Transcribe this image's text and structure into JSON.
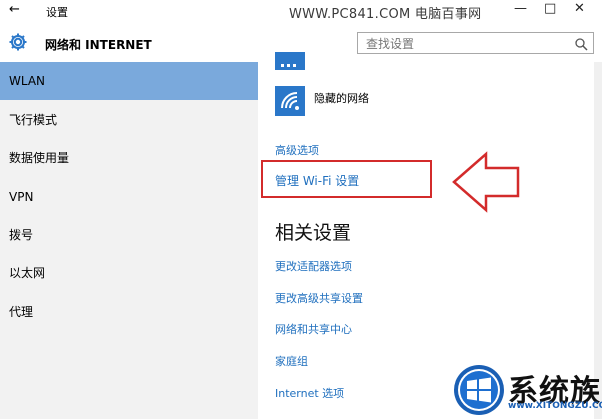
{
  "titlebar": {
    "back_glyph": "←",
    "title": "设置",
    "watermark": "WWW.PC841.COM 电脑百事网",
    "minimize": "—",
    "maximize": "□",
    "close": "✕"
  },
  "header": {
    "title": "网络和 INTERNET",
    "search_placeholder": "查找设置"
  },
  "sidebar": {
    "items": [
      {
        "label": "WLAN"
      },
      {
        "label": "飞行模式"
      },
      {
        "label": "数据使用量"
      },
      {
        "label": "VPN"
      },
      {
        "label": "拨号"
      },
      {
        "label": "以太网"
      },
      {
        "label": "代理"
      }
    ]
  },
  "main": {
    "hidden_network_label": "隐藏的网络",
    "advanced_options": "高级选项",
    "manage_wifi": "管理 Wi-Fi 设置",
    "related_heading": "相关设置",
    "related_links": [
      {
        "label": "更改适配器选项"
      },
      {
        "label": "更改高级共享设置"
      },
      {
        "label": "网络和共享中心"
      },
      {
        "label": "家庭组"
      },
      {
        "label": "Internet 选项"
      }
    ]
  },
  "logo": {
    "name": "系统族",
    "url": "www.XITONGZU.COM"
  },
  "colors": {
    "accent": "#7aa9dc",
    "link": "#1f6fbe",
    "tile": "#2a77c9",
    "highlight": "#d32b2b"
  }
}
